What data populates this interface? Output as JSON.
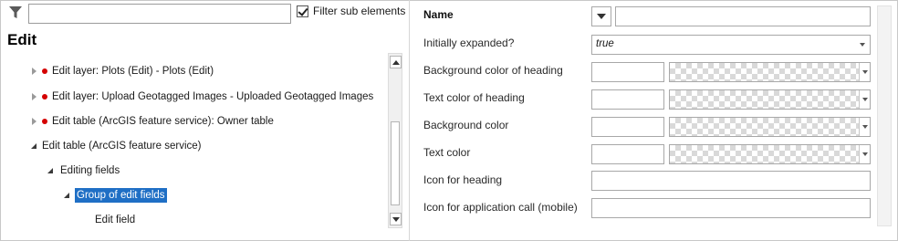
{
  "left_panel": {
    "filter_placeholder": "",
    "filter_value": "",
    "filter_sub_elements_label": "Filter sub elements",
    "filter_sub_elements_checked": true,
    "section_title": "Edit",
    "tree": [
      {
        "label": "Edit layer: Plots (Edit) - Plots (Edit)",
        "expanded": false,
        "error": true,
        "level": 0,
        "selected": false
      },
      {
        "label": "Edit layer: Upload Geotagged Images - Uploaded Geotagged Images",
        "expanded": false,
        "error": true,
        "level": 0,
        "selected": false
      },
      {
        "label": "Edit table (ArcGIS feature service): Owner table",
        "expanded": false,
        "error": true,
        "level": 0,
        "selected": false
      },
      {
        "label": "Edit table (ArcGIS feature service)",
        "expanded": true,
        "error": false,
        "level": 0,
        "selected": false
      },
      {
        "label": "Editing fields",
        "expanded": true,
        "error": false,
        "level": 1,
        "selected": false
      },
      {
        "label": "Group of edit fields",
        "expanded": true,
        "error": false,
        "level": 2,
        "selected": true
      },
      {
        "label": "Edit field",
        "expanded": null,
        "error": false,
        "level": 3,
        "selected": false
      }
    ]
  },
  "right_panel": {
    "properties": {
      "name": {
        "label": "Name",
        "value": ""
      },
      "initially_expanded": {
        "label": "Initially expanded?",
        "value": "true"
      },
      "background_color_of_heading": {
        "label": "Background color of heading",
        "value": ""
      },
      "text_color_of_heading": {
        "label": "Text color of heading",
        "value": ""
      },
      "background_color": {
        "label": "Background color",
        "value": ""
      },
      "text_color": {
        "label": "Text color",
        "value": ""
      },
      "icon_for_heading": {
        "label": "Icon for heading",
        "value": ""
      },
      "icon_for_application_call": {
        "label": "Icon for application call (mobile)",
        "value": ""
      }
    }
  },
  "icons": {
    "filter": "filter-icon",
    "expand_collapsed": "triangle-right-icon",
    "expand_expanded": "triangle-down-right-icon",
    "error": "red-dot-icon",
    "dropdown": "chevron-down-icon"
  },
  "colors": {
    "selection": "#1f6fc5",
    "error_dot": "#d40000"
  }
}
